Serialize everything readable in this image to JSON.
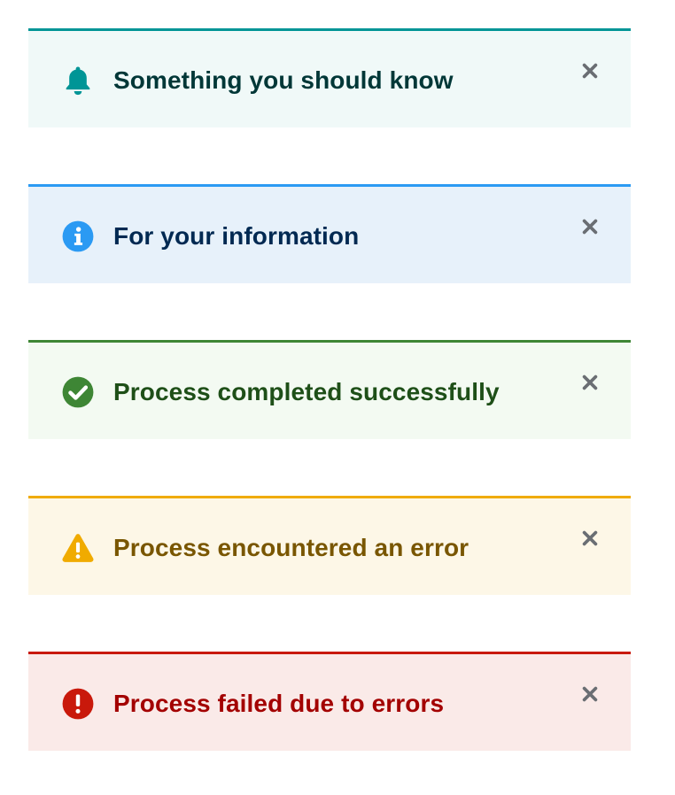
{
  "alerts": [
    {
      "variant": "default",
      "title": "Something you should know",
      "icon": "bell-icon",
      "accent_color": "#009596",
      "background_color": "#f0f9f8",
      "title_color": "#003737",
      "close_icon": "close-icon"
    },
    {
      "variant": "info",
      "title": "For your information",
      "icon": "info-circle-icon",
      "accent_color": "#2b9af3",
      "background_color": "#e7f1fa",
      "title_color": "#002952",
      "close_icon": "close-icon"
    },
    {
      "variant": "success",
      "title": "Process completed successfully",
      "icon": "check-circle-icon",
      "accent_color": "#3e8635",
      "background_color": "#f3faf2",
      "title_color": "#1e4f18",
      "close_icon": "close-icon"
    },
    {
      "variant": "warning",
      "title": "Process encountered an error",
      "icon": "warning-triangle-icon",
      "accent_color": "#f0ab00",
      "background_color": "#fdf7e7",
      "title_color": "#795600",
      "close_icon": "close-icon"
    },
    {
      "variant": "danger",
      "title": "Process failed due to errors",
      "icon": "exclamation-circle-icon",
      "accent_color": "#c9190b",
      "background_color": "#faeae8",
      "title_color": "#a30000",
      "close_icon": "close-icon"
    }
  ]
}
